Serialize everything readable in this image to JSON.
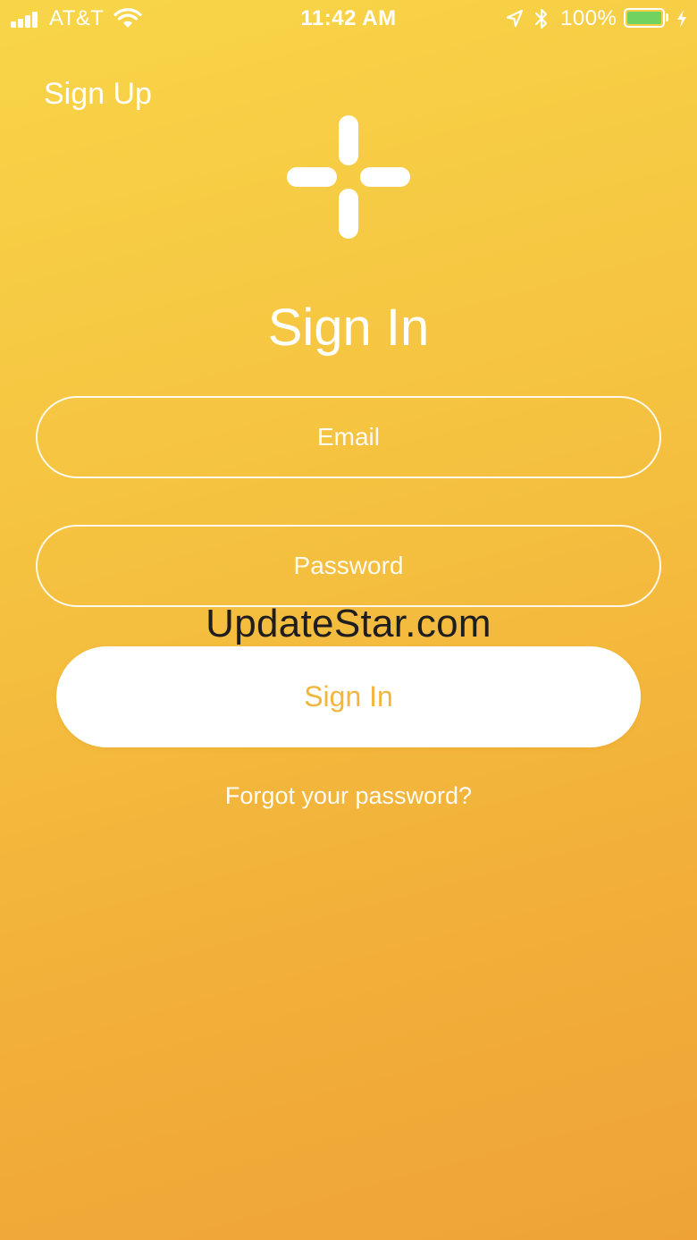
{
  "status_bar": {
    "carrier": "AT&T",
    "time": "11:42 AM",
    "battery_percent": "100%",
    "battery_level": 1.0,
    "signal_bars": 4,
    "icons": [
      "signal-icon",
      "wifi-icon",
      "location-icon",
      "bluetooth-icon",
      "battery-icon",
      "charging-icon"
    ]
  },
  "nav": {
    "sign_up_label": "Sign Up"
  },
  "logo": {
    "icon": "plus-logo-icon"
  },
  "form": {
    "title": "Sign In",
    "email_placeholder": "Email",
    "password_placeholder": "Password",
    "submit_label": "Sign In",
    "forgot_label": "Forgot your password?"
  },
  "watermark": {
    "text": "UpdateStar.com"
  },
  "colors": {
    "gradient_top": "#f8d548",
    "gradient_bottom": "#efa337",
    "accent_text": "#f1b63d",
    "battery_fill": "#72d25f"
  }
}
